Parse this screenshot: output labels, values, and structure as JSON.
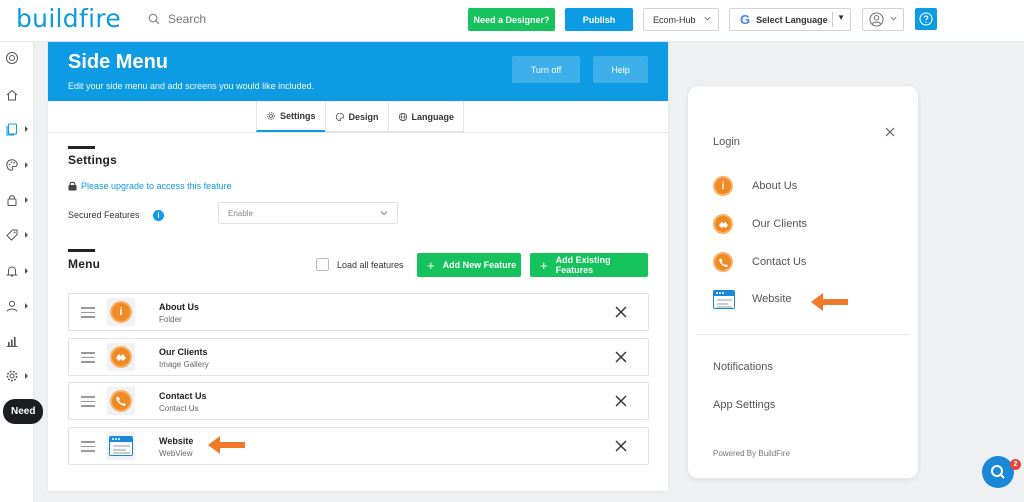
{
  "topbar": {
    "logo": "buildfire",
    "search_placeholder": "Search",
    "need_designer_label": "Need a Designer?",
    "publish_label": "Publish",
    "app_selector": "Ecom-Hub",
    "language_label": "Select Language",
    "google_g": "G"
  },
  "sidebar": {
    "need_help": "Need"
  },
  "panel": {
    "title": "Side Menu",
    "subtitle": "Edit your side menu and add screens you would like included.",
    "turn_off_label": "Turn off",
    "help_label": "Help",
    "tabs": [
      {
        "label": "Settings",
        "icon": "gear-icon"
      },
      {
        "label": "Design",
        "icon": "palette-icon"
      },
      {
        "label": "Language",
        "icon": "globe-icon"
      }
    ]
  },
  "settings": {
    "title": "Settings",
    "upgrade_link": "Please upgrade to access this feature",
    "secured_label": "Secured Features",
    "secured_value": "Enable"
  },
  "menu": {
    "title": "Menu",
    "load_all_label": "Load all features",
    "add_new_label": "Add New Feature",
    "add_existing_label": "Add Existing Features",
    "items": [
      {
        "name": "About Us",
        "type": "Folder",
        "icon": "info-icon"
      },
      {
        "name": "Our Clients",
        "type": "Image Gallery",
        "icon": "handshake-icon"
      },
      {
        "name": "Contact Us",
        "type": "Contact Us",
        "icon": "phone-icon"
      },
      {
        "name": "Website",
        "type": "WebView",
        "icon": "webview-icon"
      }
    ]
  },
  "preview": {
    "login": "Login",
    "items": [
      "About Us",
      "Our Clients",
      "Contact Us",
      "Website"
    ],
    "notifications": "Notifications",
    "app_settings": "App Settings",
    "powered_by": "Powered By BuildFire"
  },
  "support": {
    "badge_count": "2"
  },
  "colors": {
    "brand_blue": "#0d9be3",
    "green": "#15c25b",
    "orange": "#f08a24",
    "arrow_orange": "#f07a2a"
  }
}
